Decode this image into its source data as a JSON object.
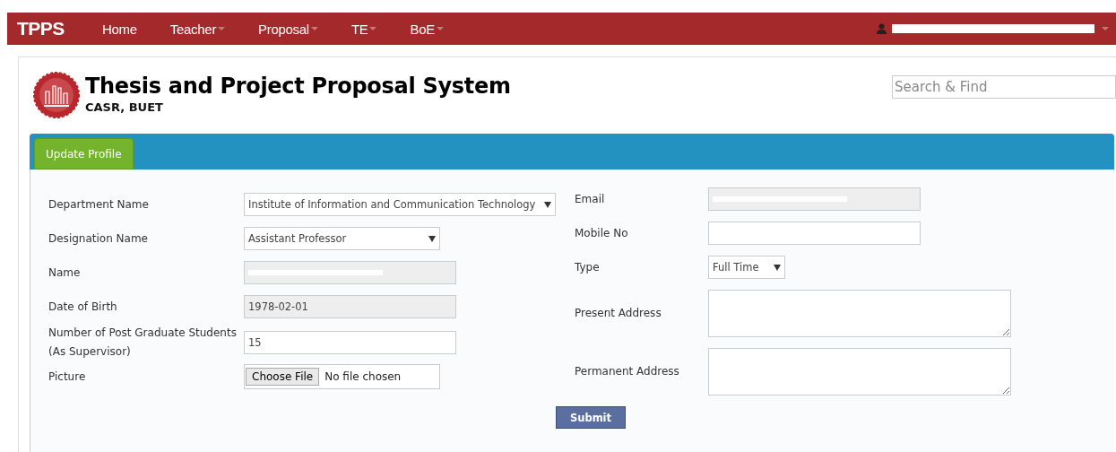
{
  "navbar": {
    "brand": "TPPS",
    "items": [
      {
        "label": "Home",
        "dropdown": false
      },
      {
        "label": "Teacher",
        "dropdown": true
      },
      {
        "label": "Proposal",
        "dropdown": true
      },
      {
        "label": "TE",
        "dropdown": true
      },
      {
        "label": "BoE",
        "dropdown": true
      }
    ]
  },
  "header": {
    "title": "Thesis and Project Proposal System",
    "subtitle": "CASR, BUET",
    "search": {
      "placeholder": "Search & Find"
    }
  },
  "tabs": [
    {
      "label": "Update Profile",
      "selected": true
    }
  ],
  "left_fields": [
    {
      "label": "Department Name",
      "kind": "select",
      "value": "Institute of Information and Communication Technology"
    },
    {
      "label": "Designation Name",
      "kind": "select",
      "value": "Assistant Professor"
    },
    {
      "label": "Name",
      "kind": "readonly"
    },
    {
      "label": "Date of Birth",
      "kind": "readonly",
      "value": "1978-02-01"
    },
    {
      "label": "Number of Post Graduate Students (As Supervisor)",
      "kind": "text",
      "value": "15"
    },
    {
      "label": "Picture",
      "kind": "file",
      "button": "Choose File",
      "value": "No file chosen"
    }
  ],
  "right_fields": [
    {
      "label": "Email",
      "kind": "readonly"
    },
    {
      "label": "Mobile No",
      "kind": "text"
    },
    {
      "label": "Type",
      "kind": "select",
      "value": "Full Time"
    },
    {
      "label": "Present Address",
      "kind": "textarea"
    },
    {
      "label": "Permanent Address",
      "kind": "textarea"
    }
  ],
  "submit": "Submit"
}
